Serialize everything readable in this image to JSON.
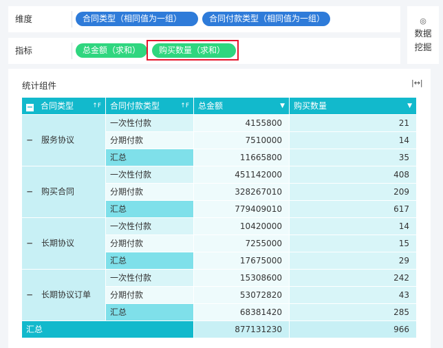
{
  "dimension_bar": {
    "label": "维度",
    "pills": [
      "合同类型（相同值为一组）",
      "合同付款类型（相同值为一组）"
    ]
  },
  "metric_bar": {
    "label": "指标",
    "pills": [
      "总金额（求和）",
      "购买数量（求和）"
    ]
  },
  "mining_button": {
    "icon": "data-mining-icon",
    "label_line1": "数据",
    "label_line2": "挖掘"
  },
  "panel": {
    "title": "统计组件",
    "expand_icon": "column-width-icon"
  },
  "table": {
    "headers": [
      "合同类型",
      "合同付款类型",
      "总金额",
      "购买数量"
    ],
    "groups": [
      {
        "name": "服务协议",
        "rows": [
          {
            "sub": "一次性付款",
            "amount": "4155800",
            "qty": "21"
          },
          {
            "sub": "分期付款",
            "amount": "7510000",
            "qty": "14"
          },
          {
            "sub": "汇总",
            "amount": "11665800",
            "qty": "35"
          }
        ]
      },
      {
        "name": "购买合同",
        "rows": [
          {
            "sub": "一次性付款",
            "amount": "451142000",
            "qty": "408"
          },
          {
            "sub": "分期付款",
            "amount": "328267010",
            "qty": "209"
          },
          {
            "sub": "汇总",
            "amount": "779409010",
            "qty": "617"
          }
        ]
      },
      {
        "name": "长期协议",
        "rows": [
          {
            "sub": "一次性付款",
            "amount": "10420000",
            "qty": "14"
          },
          {
            "sub": "分期付款",
            "amount": "7255000",
            "qty": "15"
          },
          {
            "sub": "汇总",
            "amount": "17675000",
            "qty": "29"
          }
        ]
      },
      {
        "name": "长期协议订单",
        "rows": [
          {
            "sub": "一次性付款",
            "amount": "15308600",
            "qty": "242"
          },
          {
            "sub": "分期付款",
            "amount": "53072820",
            "qty": "43"
          },
          {
            "sub": "汇总",
            "amount": "68381420",
            "qty": "285"
          }
        ]
      }
    ],
    "grand_total": {
      "label": "汇总",
      "amount": "877131230",
      "qty": "966"
    }
  },
  "colors": {
    "header": "#12b9cc",
    "pill_blue": "#2e7bd9",
    "pill_green": "#2fd67f",
    "highlight": "#e6132b"
  }
}
